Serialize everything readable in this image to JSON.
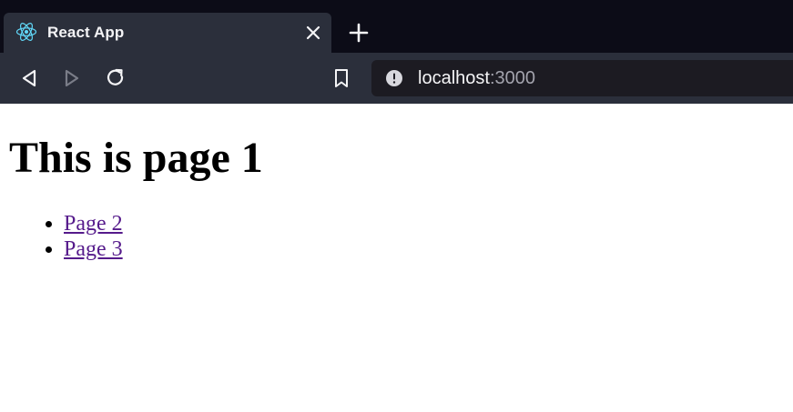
{
  "tab": {
    "title": "React App",
    "favicon": "react-logo-icon",
    "accent": "#61dafb"
  },
  "toolbar": {
    "back_icon": "back-arrow-icon",
    "forward_icon": "forward-arrow-icon",
    "reload_icon": "reload-icon",
    "bookmark_icon": "bookmark-icon"
  },
  "address_bar": {
    "host": "localhost",
    "port": ":3000",
    "info_icon": "site-info-icon"
  },
  "page": {
    "heading": "This is page 1",
    "links": [
      {
        "label": "Page 2"
      },
      {
        "label": "Page 3"
      }
    ],
    "link_color": "#551a8b"
  },
  "colors": {
    "tabstrip_bg": "#0c0c17",
    "toolbar_bg": "#2b2f3b",
    "urlbar_bg": "#1c1b22"
  }
}
